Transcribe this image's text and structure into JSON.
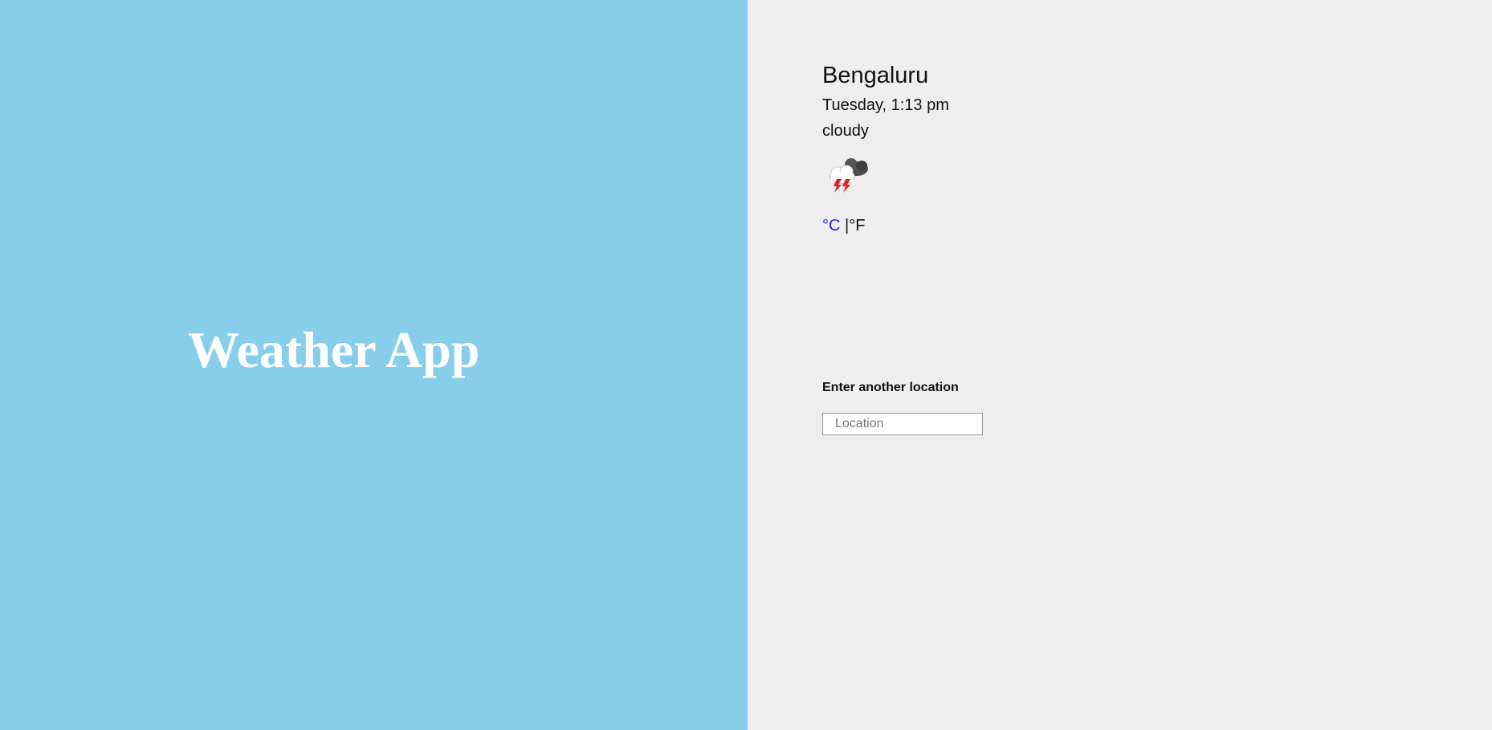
{
  "app": {
    "title": "Weather App"
  },
  "weather": {
    "city": "Bengaluru",
    "datetime": "Tuesday, 1:13 pm",
    "condition": "cloudy",
    "icon": "thunderstorm-cloud-icon"
  },
  "units": {
    "celsius": "°C",
    "separator": "|",
    "fahrenheit": "°F",
    "active": "celsius",
    "active_color": "#2222dd"
  },
  "search": {
    "label": "Enter another location",
    "placeholder": "Location",
    "value": ""
  },
  "colors": {
    "left_background": "#87ceeb",
    "right_background": "#eeeeee",
    "title_color": "#ffffff"
  }
}
